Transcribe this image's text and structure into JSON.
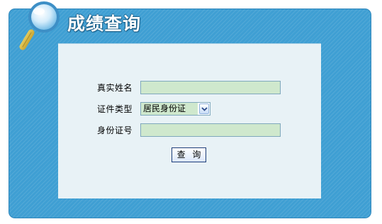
{
  "title": "成绩查询",
  "form": {
    "name_label": "真实姓名",
    "name_value": "",
    "id_type_label": "证件类型",
    "id_type_selected": "居民身份证",
    "id_number_label": "身份证号",
    "id_number_value": "",
    "submit_label": "查 询"
  },
  "colors": {
    "panel_blue": "#3f9fd3",
    "inner_bg": "#e8f2f6",
    "field_green": "#cfe8cd"
  },
  "icons": {
    "header": "magnifier-icon",
    "select": "chevron-down-icon"
  }
}
